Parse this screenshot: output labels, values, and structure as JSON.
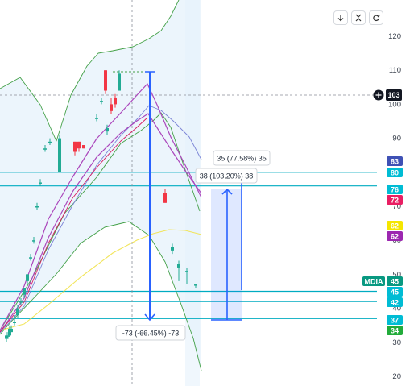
{
  "toolbar": {
    "buttons": [
      {
        "name": "scroll-down-button",
        "icon": "arrow-down-icon"
      },
      {
        "name": "collapse-button",
        "icon": "collapse-arrows-icon"
      },
      {
        "name": "reset-button",
        "icon": "refresh-icon"
      }
    ]
  },
  "crosshair": {
    "price_label": "103"
  },
  "price_axis": {
    "ticks": [
      "120",
      "110",
      "100",
      "90",
      "80",
      "70",
      "60",
      "50",
      "40",
      "30",
      "20"
    ]
  },
  "price_badges": [
    {
      "text": "83",
      "color": "#3f51b5"
    },
    {
      "text": "80",
      "color": "#00bcd4"
    },
    {
      "text": "76",
      "color": "#00bcd4"
    },
    {
      "text": "72",
      "color": "#e91e63"
    },
    {
      "text": "62",
      "color": "#f5e600"
    },
    {
      "text": "62",
      "color": "#9c27b0"
    },
    {
      "text": "45",
      "color": "#089981"
    },
    {
      "text": "45",
      "color": "#00bcd4"
    },
    {
      "text": "42",
      "color": "#00bcd4"
    },
    {
      "text": "37",
      "color": "#00bcd4"
    },
    {
      "text": "34",
      "color": "#22ab3a"
    }
  ],
  "symbol_badge": {
    "text": "MDIA",
    "color": "#089981"
  },
  "measurements": {
    "down": "-73 (-66.45%) -73",
    "up_short": "38 (103.20%) 38",
    "up_long": "35 (77.58%) 35"
  },
  "chart_data": {
    "type": "candlestick",
    "ylim": [
      20,
      123
    ],
    "horizontal_levels": [
      80,
      76,
      45,
      42,
      37
    ],
    "candles": [
      {
        "o": 31,
        "h": 33,
        "l": 30,
        "c": 32
      },
      {
        "o": 32,
        "h": 33,
        "l": 31,
        "c": 32
      },
      {
        "o": 32,
        "h": 35,
        "l": 32,
        "c": 34
      },
      {
        "o": 33,
        "h": 35,
        "l": 33,
        "c": 34
      },
      {
        "o": 36,
        "h": 38,
        "l": 35,
        "c": 36
      },
      {
        "o": 38,
        "h": 41,
        "l": 37,
        "c": 40
      },
      {
        "o": 42,
        "h": 43,
        "l": 41,
        "c": 42
      },
      {
        "o": 44,
        "h": 46,
        "l": 43,
        "c": 46
      },
      {
        "o": 48,
        "h": 50,
        "l": 47,
        "c": 50
      },
      {
        "o": 55,
        "h": 56,
        "l": 54,
        "c": 55
      },
      {
        "o": 60,
        "h": 61,
        "l": 59,
        "c": 60
      },
      {
        "o": 70,
        "h": 71,
        "l": 69,
        "c": 70
      },
      {
        "o": 77,
        "h": 78,
        "l": 76,
        "c": 77
      },
      {
        "o": 87,
        "h": 88,
        "l": 86,
        "c": 87
      },
      {
        "o": 89,
        "h": 90,
        "l": 88,
        "c": 89
      },
      {
        "o": 80,
        "h": 91,
        "l": 80,
        "c": 90
      },
      {
        "o": 89,
        "h": 89,
        "l": 85,
        "c": 86
      },
      {
        "o": 89,
        "h": 89,
        "l": 86,
        "c": 87
      },
      {
        "o": 88,
        "h": 88,
        "l": 87,
        "c": 87
      },
      {
        "o": 96,
        "h": 97,
        "l": 95,
        "c": 96
      },
      {
        "o": 101,
        "h": 102,
        "l": 100,
        "c": 101
      },
      {
        "o": 110,
        "h": 110,
        "l": 103,
        "c": 104
      },
      {
        "o": 92,
        "h": 94,
        "l": 91,
        "c": 93
      },
      {
        "o": 100,
        "h": 102,
        "l": 97,
        "c": 98
      },
      {
        "o": 102,
        "h": 103,
        "l": 99,
        "c": 100
      },
      {
        "o": 104,
        "h": 110,
        "l": 104,
        "c": 109
      },
      {
        "o": 74,
        "h": 75,
        "l": 71,
        "c": 71
      },
      {
        "o": 57,
        "h": 59,
        "l": 56,
        "c": 58
      },
      {
        "o": 52,
        "h": 54,
        "l": 48,
        "c": 53
      },
      {
        "o": 51,
        "h": 52,
        "l": 47,
        "c": 51
      },
      {
        "o": 47,
        "h": 47,
        "l": 46,
        "c": 47
      }
    ]
  }
}
